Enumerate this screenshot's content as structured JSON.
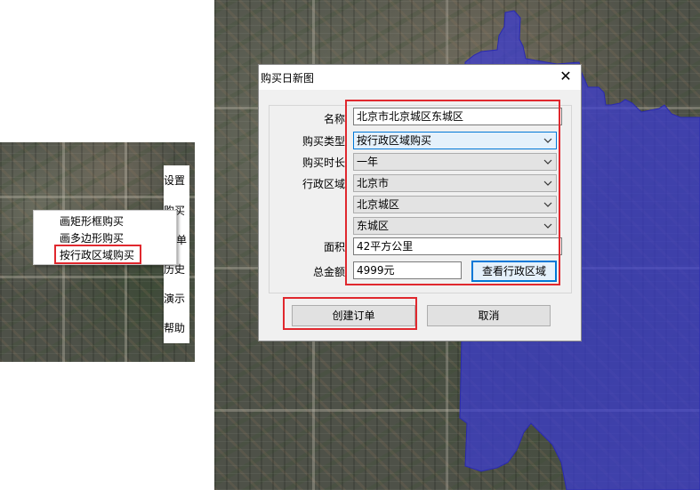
{
  "side_toolbar": {
    "tabs": [
      "设置",
      "购买",
      "单",
      "历史",
      "演示",
      "帮助"
    ]
  },
  "context_menu": {
    "items": [
      "画矩形框购买",
      "画多边形购买",
      "按行政区域购买"
    ]
  },
  "dialog": {
    "title": "购买日新图",
    "close_glyph": "✕",
    "fields": {
      "name_label": "名称",
      "name_value": "北京市北京城区东城区",
      "purchase_type_label": "购买类型",
      "purchase_type_value": "按行政区域购买",
      "duration_label": "购买时长",
      "duration_value": "一年",
      "region_label": "行政区域",
      "province_value": "北京市",
      "city_value": "北京城区",
      "district_value": "东城区",
      "area_label": "面积",
      "area_value": "42平方公里",
      "total_label": "总金额",
      "total_value": "4999元"
    },
    "buttons": {
      "view_region": "查看行政区域",
      "create_order": "创建订单",
      "cancel": "取消"
    }
  },
  "colors": {
    "highlight_red": "#e0282e",
    "region_overlay": "#3c3cd2",
    "focus_blue": "#0078d7"
  },
  "icons": {
    "close": "close-icon",
    "dropdown": "chevron-down-icon"
  }
}
